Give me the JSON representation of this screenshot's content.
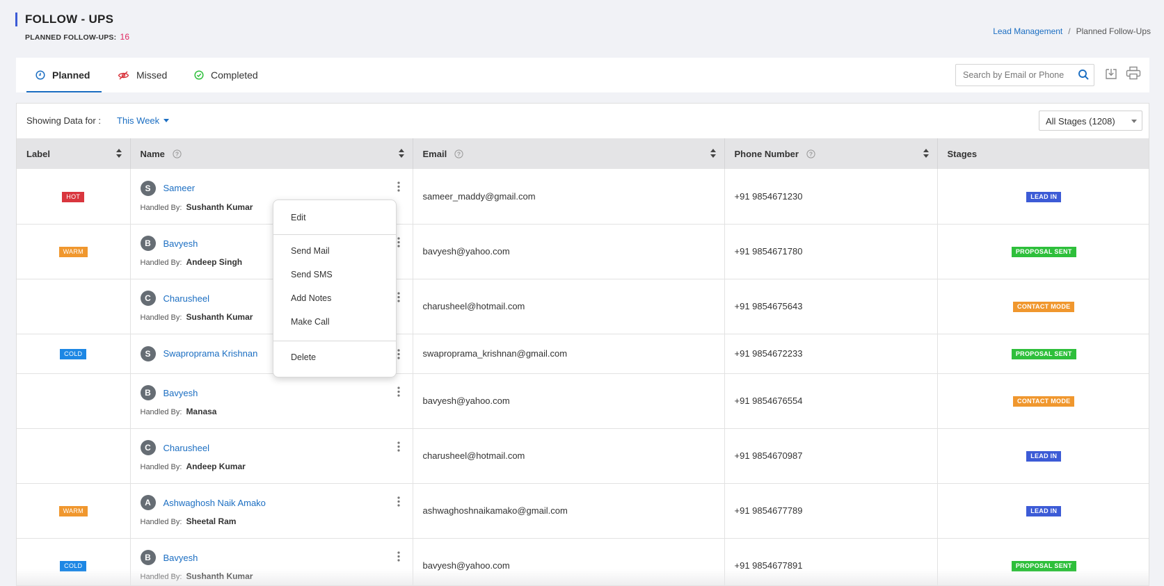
{
  "header": {
    "title": "FOLLOW - UPS",
    "planned_label": "PLANNED FOLLOW-UPS:",
    "planned_count": "16"
  },
  "breadcrumb": {
    "parent": "Lead Management",
    "separator": "/",
    "current": "Planned Follow-Ups"
  },
  "tabs": [
    {
      "label": "Planned",
      "icon": "clock-icon",
      "active": true
    },
    {
      "label": "Missed",
      "icon": "eye-off-icon",
      "active": false
    },
    {
      "label": "Completed",
      "icon": "check-circle-icon",
      "active": false
    }
  ],
  "search": {
    "placeholder": "Search by Email or Phone"
  },
  "toolbar": {
    "download_icon": "download-icon",
    "print_icon": "print-icon"
  },
  "filters": {
    "showing_label": "Showing Data for :",
    "period": "This Week",
    "stage_filter": "All Stages (1208)"
  },
  "table": {
    "columns": [
      "Label",
      "Name",
      "Email",
      "Phone Number",
      "Stages"
    ],
    "handled_by_label": "Handled By:",
    "rows": [
      {
        "label": "HOT",
        "initial": "S",
        "name": "Sameer",
        "handled_by": "Sushanth Kumar",
        "email": "sameer_maddy@gmail.com",
        "phone": "+91 9854671230",
        "stage": "LEAD IN"
      },
      {
        "label": "WARM",
        "initial": "B",
        "name": "Bavyesh",
        "handled_by": "Andeep Singh",
        "email": "bavyesh@yahoo.com",
        "phone": "+91 9854671780",
        "stage": "PROPOSAL SENT"
      },
      {
        "label": "",
        "initial": "C",
        "name": "Charusheel",
        "handled_by": "Sushanth Kumar",
        "email": "charusheel@hotmail.com",
        "phone": "+91 9854675643",
        "stage": "CONTACT MODE"
      },
      {
        "label": "COLD",
        "initial": "S",
        "name": "Swaproprama Krishnan",
        "handled_by": "",
        "email": "swaproprama_krishnan@gmail.com",
        "phone": "+91 9854672233",
        "stage": "PROPOSAL SENT"
      },
      {
        "label": "",
        "initial": "B",
        "name": "Bavyesh",
        "handled_by": "Manasa",
        "email": "bavyesh@yahoo.com",
        "phone": "+91 9854676554",
        "stage": "CONTACT MODE"
      },
      {
        "label": "",
        "initial": "C",
        "name": "Charusheel",
        "handled_by": "Andeep Kumar",
        "email": "charusheel@hotmail.com",
        "phone": "+91 9854670987",
        "stage": "LEAD IN"
      },
      {
        "label": "WARM",
        "initial": "A",
        "name": "Ashwaghosh Naik Amako",
        "handled_by": "Sheetal Ram",
        "email": "ashwaghoshnaikamako@gmail.com",
        "phone": "+91 9854677789",
        "stage": "LEAD IN"
      },
      {
        "label": "COLD",
        "initial": "B",
        "name": "Bavyesh",
        "handled_by": "Sushanth Kumar",
        "email": "bavyesh@yahoo.com",
        "phone": "+91 9854677891",
        "stage": "PROPOSAL SENT"
      }
    ]
  },
  "context_menu": {
    "edit": "Edit",
    "send_mail": "Send Mail",
    "send_sms": "Send SMS",
    "add_notes": "Add Notes",
    "make_call": "Make Call",
    "delete": "Delete"
  },
  "colors": {
    "accent": "#1b6ec2",
    "label_hot": "#d9363e",
    "label_warm": "#f0972e",
    "label_cold": "#1d87e4",
    "stage_lead_in": "#3c5bd6",
    "stage_proposal_sent": "#2ebf3b",
    "stage_contact_mode": "#f0972e",
    "count_highlight": "#e0245e"
  }
}
